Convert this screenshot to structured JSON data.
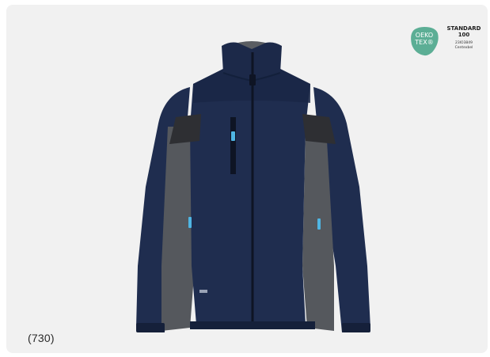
{
  "caption": "(730)",
  "certification": {
    "badge_line1": "OEKO",
    "badge_line2": "TEX®",
    "standard": "STANDARD",
    "number": "100",
    "cert_number": "23IO3849",
    "institute": "Centexbel"
  },
  "colors": {
    "background": "#f1f1f1",
    "jacket_body": "#1f2d4f",
    "jacket_side_panels": "#55585d",
    "zipper_pull_accent": "#4fb5e3",
    "badge_green": "#5cae95"
  },
  "product": {
    "icon": "fleece-jacket-image"
  }
}
